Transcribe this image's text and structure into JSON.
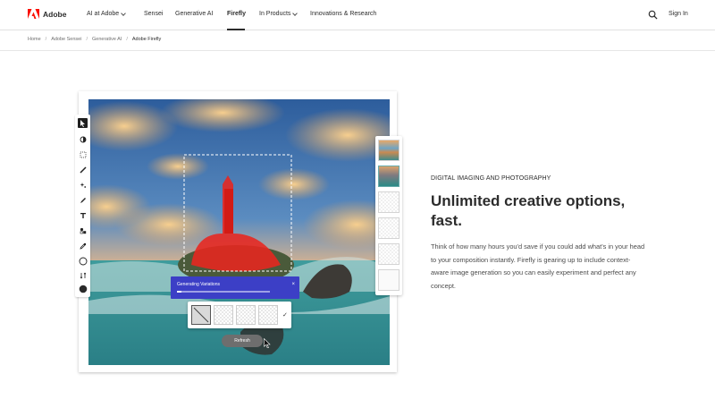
{
  "header": {
    "logo_text": "Adobe",
    "nav": [
      {
        "label": "AI at Adobe",
        "dropdown": true
      },
      {
        "label": "Sensei",
        "dropdown": false
      },
      {
        "label": "Generative AI",
        "dropdown": false
      },
      {
        "label": "Firefly",
        "dropdown": false,
        "active": true
      },
      {
        "label": "In Products",
        "dropdown": true
      },
      {
        "label": "Innovations & Research",
        "dropdown": false
      }
    ],
    "search_icon": "search-icon",
    "signin_label": "Sign In"
  },
  "breadcrumb": [
    "Home",
    "Adobe Sensei",
    "Generative AI",
    "Adobe Firefly"
  ],
  "hero": {
    "generating_label": "Generating Variations",
    "generating_progress": 0.05,
    "refresh_label": "Refresh",
    "close_glyph": "×",
    "check_glyph": "✓"
  },
  "content": {
    "eyebrow": "DIGITAL IMAGING AND PHOTOGRAPHY",
    "headline": "Unlimited creative options, fast.",
    "body": "Think of how many hours you'd save if you could add what's in your head to your composition instantly. Firefly is gearing up to include context-aware image generation so you can easily experiment and perfect any concept."
  },
  "colors": {
    "brand": "#fa0f00",
    "generating_bar": "#3c3fc6",
    "text": "#2c2c2c"
  }
}
